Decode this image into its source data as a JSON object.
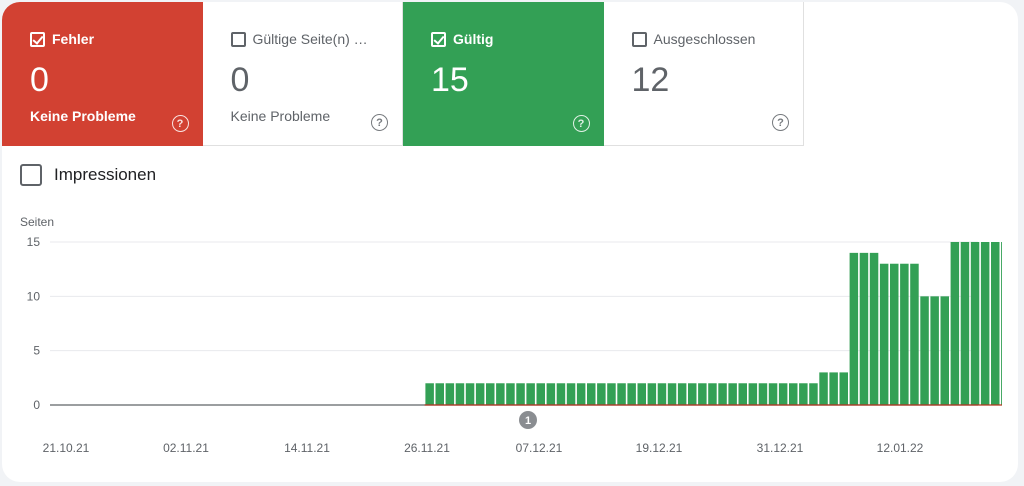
{
  "tiles": [
    {
      "label": "Fehler",
      "value": "0",
      "sub": "Keine Probleme",
      "checked": true
    },
    {
      "label": "Gültige Seite(n) …",
      "value": "0",
      "sub": "Keine Probleme",
      "checked": false
    },
    {
      "label": "Gültig",
      "value": "15",
      "sub": "",
      "checked": true
    },
    {
      "label": "Ausgeschlossen",
      "value": "12",
      "sub": "",
      "checked": false
    }
  ],
  "help_glyph": "?",
  "impressions_label": "Impressionen",
  "chart_data": {
    "type": "bar",
    "ylabel": "Seiten",
    "ylim": [
      0,
      15
    ],
    "yticks": [
      0,
      5,
      10,
      15
    ],
    "xtick_labels": [
      "21.10.21",
      "02.11.21",
      "14.11.21",
      "26.11.21",
      "07.12.21",
      "19.12.21",
      "31.12.21",
      "12.01.22"
    ],
    "annotation": "1",
    "bar_color": "#33a055",
    "values": [
      0,
      0,
      0,
      0,
      0,
      0,
      0,
      0,
      0,
      0,
      0,
      0,
      0,
      0,
      0,
      0,
      0,
      0,
      0,
      0,
      0,
      0,
      0,
      0,
      0,
      0,
      0,
      0,
      0,
      0,
      0,
      0,
      0,
      0,
      0,
      0,
      2,
      2,
      2,
      2,
      2,
      2,
      2,
      2,
      2,
      2,
      2,
      2,
      2,
      2,
      2,
      2,
      2,
      2,
      2,
      2,
      2,
      2,
      2,
      2,
      2,
      2,
      2,
      2,
      2,
      2,
      2,
      2,
      2,
      2,
      2,
      2,
      2,
      2,
      2,
      3,
      3,
      3,
      14,
      14,
      14,
      13,
      13,
      13,
      13,
      10,
      10,
      10,
      15,
      15,
      15,
      15,
      15,
      15,
      15
    ]
  }
}
